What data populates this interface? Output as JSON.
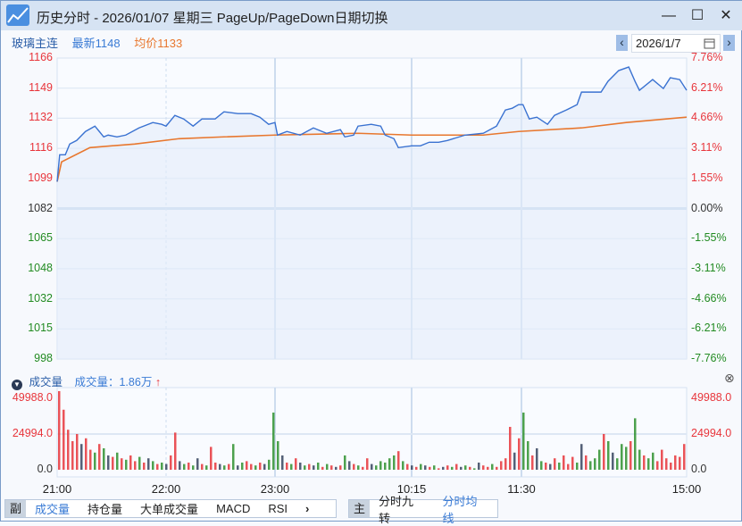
{
  "window": {
    "title": "历史分时 - 2026/01/07 星期三 PageUp/PageDown日期切换",
    "minimize": "—",
    "maximize": "☐",
    "close": "✕"
  },
  "info": {
    "symbol": "玻璃主连",
    "latest": "最新1148",
    "avg": "均价1133"
  },
  "date_picker": {
    "value": "2026/1/7",
    "prev": "‹",
    "next": "›"
  },
  "colors": {
    "price": "#3a72d1",
    "avg": "#e8772e",
    "up": "#e8353b",
    "down": "#228b22",
    "flat": "#2b3a55"
  },
  "price_axis": {
    "left": [
      "1166",
      "1149",
      "1132",
      "1116",
      "1099",
      "1082",
      "1065",
      "1048",
      "1032",
      "1015",
      "998"
    ],
    "right": [
      "7.76%",
      "6.21%",
      "4.66%",
      "3.11%",
      "1.55%",
      "0.00%",
      "-1.55%",
      "-3.11%",
      "-4.66%",
      "-6.21%",
      "-7.76%"
    ],
    "range": [
      998,
      1166
    ]
  },
  "volume_panel": {
    "title": "成交量",
    "value_label": "成交量：1.86万",
    "up_arrow": "↑",
    "close_icon": "⊗",
    "ticks": [
      "49988.0",
      "24994.0",
      "0.0"
    ],
    "max": 49988
  },
  "time_labels": [
    "21:00",
    "22:00",
    "23:00",
    "10:15",
    "11:30",
    "15:00"
  ],
  "sub_tabs": {
    "head": "副",
    "items": [
      "成交量",
      "持仓量",
      "大单成交量",
      "MACD",
      "RSI"
    ],
    "more": "›"
  },
  "main_tabs": {
    "head": "主",
    "items": [
      "分时九转",
      "分时均线"
    ]
  },
  "chart_data": {
    "type": "line",
    "x_unit": "session progress %",
    "price": [
      [
        0,
        1097
      ],
      [
        0.4,
        1112
      ],
      [
        1.3,
        1112
      ],
      [
        2,
        1118
      ],
      [
        3.1,
        1120
      ],
      [
        4.5,
        1125
      ],
      [
        6,
        1128
      ],
      [
        6.7,
        1125
      ],
      [
        7.4,
        1122
      ],
      [
        8.1,
        1123
      ],
      [
        9.5,
        1122
      ],
      [
        10.9,
        1123
      ],
      [
        13,
        1127
      ],
      [
        15.2,
        1130
      ],
      [
        16.6,
        1129
      ],
      [
        17.3,
        1128
      ],
      [
        18.7,
        1134
      ],
      [
        20.1,
        1132
      ],
      [
        21.6,
        1128
      ],
      [
        23,
        1132
      ],
      [
        25.1,
        1132
      ],
      [
        26.5,
        1136
      ],
      [
        28.7,
        1135
      ],
      [
        30.8,
        1135
      ],
      [
        32.2,
        1133
      ],
      [
        33.6,
        1129
      ],
      [
        34.6,
        1130
      ],
      [
        35,
        1123
      ],
      [
        36.5,
        1125
      ],
      [
        38.6,
        1123
      ],
      [
        40.7,
        1127
      ],
      [
        42.8,
        1124
      ],
      [
        45,
        1126
      ],
      [
        45.7,
        1122
      ],
      [
        47.1,
        1123
      ],
      [
        47.8,
        1128
      ],
      [
        49.9,
        1129
      ],
      [
        51.4,
        1128
      ],
      [
        52.1,
        1123
      ],
      [
        53.5,
        1121
      ],
      [
        54.2,
        1116
      ],
      [
        56.3,
        1117
      ],
      [
        57.7,
        1117
      ],
      [
        59.1,
        1119
      ],
      [
        60.6,
        1119
      ],
      [
        62,
        1120
      ],
      [
        64.8,
        1123
      ],
      [
        67.7,
        1124
      ],
      [
        69.8,
        1128
      ],
      [
        71.2,
        1137
      ],
      [
        72.3,
        1138
      ],
      [
        73.3,
        1140
      ],
      [
        74,
        1140
      ],
      [
        75,
        1132
      ],
      [
        76.2,
        1133
      ],
      [
        77.9,
        1129
      ],
      [
        79,
        1134
      ],
      [
        80.9,
        1137
      ],
      [
        82.6,
        1140
      ],
      [
        83.3,
        1147
      ],
      [
        84.7,
        1147
      ],
      [
        86.4,
        1147
      ],
      [
        87.5,
        1153
      ],
      [
        89.2,
        1159
      ],
      [
        90.8,
        1161
      ],
      [
        91.8,
        1153
      ],
      [
        92.5,
        1148
      ],
      [
        94.6,
        1154
      ],
      [
        96.3,
        1149
      ],
      [
        97.4,
        1155
      ],
      [
        98.9,
        1154
      ],
      [
        100,
        1148
      ]
    ],
    "avg": [
      [
        0,
        1097
      ],
      [
        0.7,
        1108
      ],
      [
        5.2,
        1116
      ],
      [
        12.3,
        1118
      ],
      [
        19.4,
        1121
      ],
      [
        26.5,
        1122
      ],
      [
        34.6,
        1123
      ],
      [
        47.8,
        1124
      ],
      [
        56.3,
        1123
      ],
      [
        67.7,
        1123
      ],
      [
        73.3,
        1125
      ],
      [
        83.3,
        1127
      ],
      [
        90.4,
        1130
      ],
      [
        100,
        1133
      ]
    ],
    "volume": [
      55000,
      42000,
      28000,
      20000,
      25000,
      18000,
      22000,
      14000,
      12000,
      18000,
      15000,
      10000,
      9000,
      12000,
      8000,
      7000,
      10000,
      6000,
      9000,
      5000,
      8000,
      6000,
      4000,
      5000,
      4000,
      10000,
      26000,
      6000,
      4000,
      5000,
      3000,
      8000,
      4000,
      3000,
      16000,
      5000,
      4000,
      3000,
      4000,
      18000,
      3000,
      5000,
      6000,
      4000,
      3000,
      5000,
      4000,
      7000,
      40000,
      20000,
      10000,
      5000,
      4000,
      8000,
      5000,
      3000,
      4000,
      3000,
      5000,
      2000,
      4000,
      3000,
      2000,
      3000,
      10000,
      6000,
      4000,
      3000,
      2000,
      8000,
      4000,
      3000,
      6000,
      5000,
      8000,
      10000,
      13000,
      6000,
      4000,
      3000,
      2000,
      4000,
      3000,
      2000,
      3000,
      1000,
      2000,
      3000,
      2000,
      4000,
      2000,
      3000,
      2000,
      1000,
      5000,
      3000,
      2000,
      4000,
      2000,
      6000,
      8000,
      30000,
      12000,
      22000,
      40000,
      20000,
      10000,
      15000,
      6000,
      5000,
      4000,
      8000,
      5000,
      10000,
      4000,
      9000,
      5000,
      18000,
      10000,
      6000,
      8000,
      14000,
      25000,
      20000,
      12000,
      8000,
      18000,
      16000,
      20000,
      36000,
      14000,
      10000,
      8000,
      12000,
      6000,
      14000,
      8000,
      5000,
      10000,
      9000,
      18000
    ],
    "volume_dir": "rrrrrkrrgrgkrgrgrrgrkgrgkrrkgrgkrgrrkgrgkgrrgrkgggkrgrkgrkgrgrkrgkrgrrkgggggrgrkrgkrgrkrgrkgrgkrrgrrrrkrggrkgrkrgrrrgkrgggrgkgggrggrgg"
  }
}
